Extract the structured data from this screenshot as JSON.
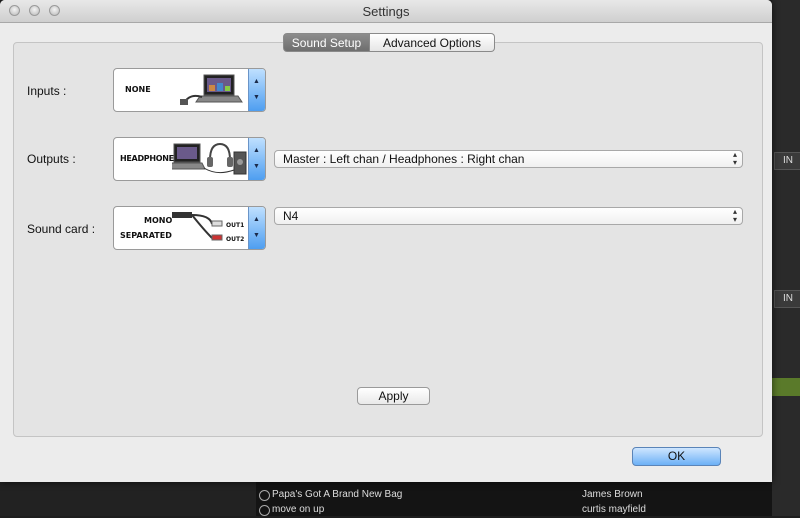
{
  "window": {
    "title": "Settings"
  },
  "tabs": [
    {
      "label": "Sound Setup",
      "active": true
    },
    {
      "label": "Advanced Options",
      "active": false
    }
  ],
  "inputs": {
    "label": "Inputs :",
    "picker_text": "NONE"
  },
  "outputs": {
    "label": "Outputs :",
    "picker_text": "HEADPHONES",
    "select_value": "Master : Left chan / Headphones : Right chan"
  },
  "sound_card": {
    "label": "Sound card :",
    "picker_text_1": "MONO",
    "picker_text_2": "SEPARATED",
    "out1": "OUT1",
    "out2": "OUT2",
    "select_value": "N4"
  },
  "buttons": {
    "apply": "Apply",
    "ok": "OK"
  },
  "background_app": {
    "in_label": "IN",
    "tracks": [
      {
        "title": "Papa's Got A Brand New Bag",
        "artist": "James Brown"
      },
      {
        "title": "move on up",
        "artist": "curtis mayfield"
      }
    ]
  },
  "icons": {
    "traffic_lights": [
      "close-icon",
      "minimize-icon",
      "zoom-icon"
    ],
    "stepper": [
      "chevron-up-icon",
      "chevron-down-icon"
    ]
  }
}
